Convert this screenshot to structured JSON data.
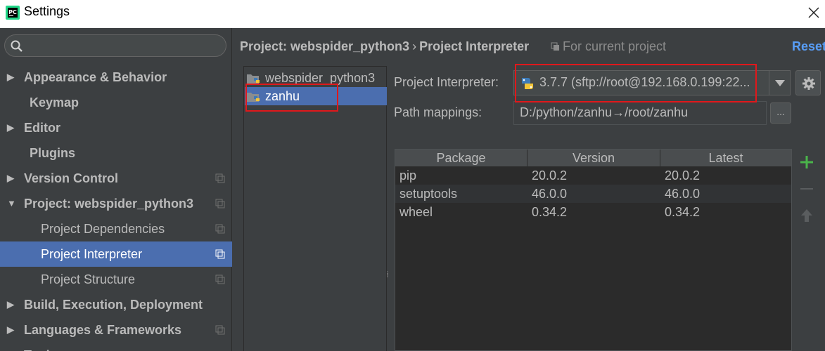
{
  "window": {
    "title": "Settings",
    "app_icon": "pycharm-logo",
    "close_glyph": "✕"
  },
  "sidebar": {
    "search": {
      "value": "",
      "placeholder": ""
    },
    "items": [
      {
        "label": "Appearance & Behavior",
        "expandable": true,
        "expanded": false,
        "bold": true,
        "copy_icon": false
      },
      {
        "label": "Keymap",
        "expandable": false,
        "bold": true,
        "copy_icon": false
      },
      {
        "label": "Editor",
        "expandable": true,
        "expanded": false,
        "bold": true,
        "copy_icon": false
      },
      {
        "label": "Plugins",
        "expandable": false,
        "bold": true,
        "copy_icon": false
      },
      {
        "label": "Version Control",
        "expandable": true,
        "expanded": false,
        "bold": true,
        "copy_icon": true
      },
      {
        "label": "Project: webspider_python3",
        "expandable": true,
        "expanded": true,
        "bold": true,
        "copy_icon": true
      },
      {
        "label": "Project Dependencies",
        "expandable": false,
        "bold": false,
        "copy_icon": true
      },
      {
        "label": "Project Interpreter",
        "expandable": false,
        "bold": false,
        "copy_icon": true,
        "selected": true
      },
      {
        "label": "Project Structure",
        "expandable": false,
        "bold": false,
        "copy_icon": true
      },
      {
        "label": "Build, Execution, Deployment",
        "expandable": true,
        "expanded": false,
        "bold": true,
        "copy_icon": false
      },
      {
        "label": "Languages & Frameworks",
        "expandable": true,
        "expanded": false,
        "bold": true,
        "copy_icon": true
      },
      {
        "label": "Tools",
        "expandable": true,
        "expanded": false,
        "bold": true,
        "copy_icon": false
      }
    ]
  },
  "header": {
    "breadcrumb_project": "Project: webspider_python3",
    "breadcrumb_sep": "›",
    "breadcrumb_page": "Project Interpreter",
    "scope_note": "For current project",
    "reset_label": "Reset"
  },
  "projects": [
    {
      "name": "webspider_python3",
      "selected": false
    },
    {
      "name": "zanhu",
      "selected": true
    }
  ],
  "interpreter": {
    "label": "Project Interpreter:",
    "value": "3.7.7 (sftp://root@192.168.0.199:22...",
    "gear_icon": "gear-icon"
  },
  "path_mappings": {
    "label": "Path mappings:",
    "value": "D:/python/zanhu→/root/zanhu",
    "browse_label": "..."
  },
  "packages": {
    "columns": [
      "Package",
      "Version",
      "Latest"
    ],
    "rows": [
      [
        "pip",
        "20.0.2",
        "20.0.2"
      ],
      [
        "setuptools",
        "46.0.0",
        "46.0.0"
      ],
      [
        "wheel",
        "0.34.2",
        "0.34.2"
      ]
    ],
    "toolbar": [
      "plus-icon",
      "minus-icon",
      "upgrade-icon"
    ]
  },
  "colors": {
    "selection": "#4b6eaf",
    "highlight_box": "#e0181b",
    "add_green": "#4ab44a",
    "link_blue": "#589df6"
  }
}
